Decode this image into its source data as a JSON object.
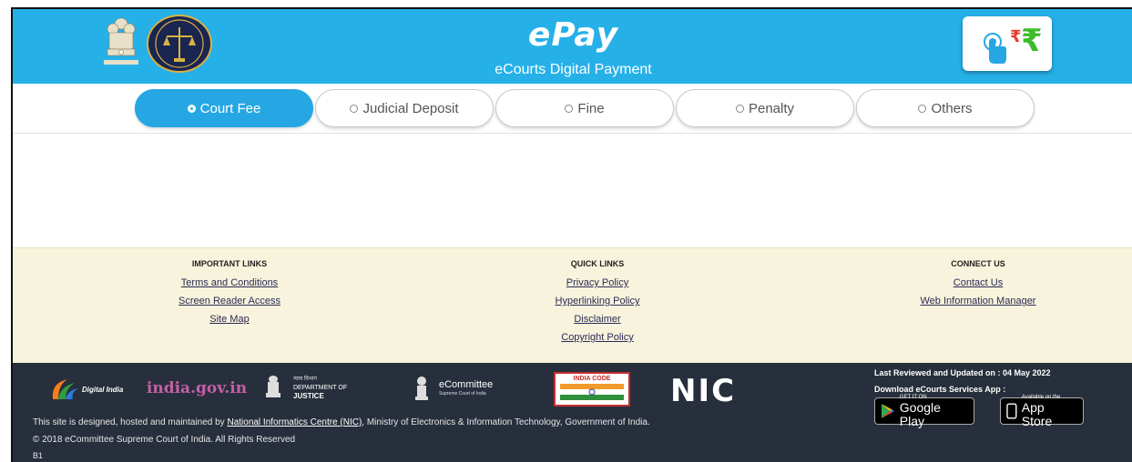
{
  "header": {
    "title": "ePay",
    "subtitle": "eCourts Digital Payment",
    "rupee_symbol": "₹"
  },
  "tabs": [
    {
      "label": "Court Fee",
      "active": true
    },
    {
      "label": "Judicial Deposit",
      "active": false
    },
    {
      "label": "Fine",
      "active": false
    },
    {
      "label": "Penalty",
      "active": false
    },
    {
      "label": "Others",
      "active": false
    }
  ],
  "links": {
    "important": {
      "heading": "IMPORTANT LINKS",
      "items": [
        "Terms and Conditions",
        "Screen Reader Access",
        "Site Map"
      ]
    },
    "quick": {
      "heading": "QUICK LINKS",
      "items": [
        "Privacy Policy",
        "Hyperlinking Policy",
        "Disclaimer",
        "Copyright Policy"
      ]
    },
    "connect": {
      "heading": "CONNECT US",
      "items": [
        "Contact Us",
        "Web Information Manager"
      ]
    }
  },
  "footer": {
    "logos": {
      "digital_india": "Digital India",
      "india_gov": "india.gov.in",
      "doj_hindi": "न्याय विभाग",
      "doj_line1": "DEPARTMENT OF",
      "doj_line2": "JUSTICE",
      "ecommittee": "eCommittee",
      "ecommittee_sub": "Supreme Court of India",
      "india_code": "INDIA CODE",
      "nic": "NIC"
    },
    "credit_prefix": "This site is designed, hosted and maintained by",
    "credit_link": "National Informatics Centre (NIC)",
    "credit_suffix": ", Ministry of Electronics & Information Technology, Government of India.",
    "copyright": "© 2018 eCommittee Supreme Court of India. All Rights Reserved",
    "build": "B1",
    "reviewed": "Last Reviewed and Updated on : 04 May 2022",
    "download": "Download eCourts Services App :",
    "google_play_small": "GET IT ON",
    "google_play_big": "Google Play",
    "app_store_small": "Available on the",
    "app_store_big": "App Store"
  },
  "colors": {
    "header_bg": "#26b0e8",
    "active_tab": "#26a7e4",
    "links_bg": "#f8f3dc",
    "footer_bg": "#272f3c"
  }
}
